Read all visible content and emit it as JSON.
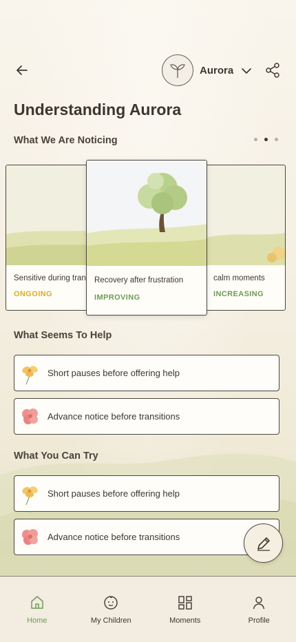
{
  "header": {
    "child_name": "Aurora",
    "page_title": "Understanding Aurora"
  },
  "noticing": {
    "title": "What We Are Noticing",
    "carousel_page": 2,
    "carousel_total": 3,
    "cards": [
      {
        "label": "Sensitive during  tran",
        "status": "ONGOING",
        "status_color": "#d6ad2c"
      },
      {
        "label": "Recovery after frustration",
        "status": "IMPROVING",
        "status_color": "#6f9a5a"
      },
      {
        "label": "calm moments",
        "status": "INCREASING",
        "status_color": "#6f9a5a"
      }
    ]
  },
  "helps": {
    "title": "What Seems To Help",
    "items": [
      {
        "label": "Short pauses before offering help",
        "icon": "yellow-flower-icon"
      },
      {
        "label": "Advance notice before transitions",
        "icon": "red-flower-icon"
      }
    ]
  },
  "try": {
    "title": "What You Can Try",
    "items": [
      {
        "label": "Short pauses before offering help",
        "icon": "yellow-flower-icon"
      },
      {
        "label": "Advance notice before transitions",
        "icon": "red-flower-icon"
      }
    ]
  },
  "nav": {
    "home": "Home",
    "children": "My Children",
    "moments": "Moments",
    "profile": "Profile",
    "active_color": "#6f9a5a"
  }
}
